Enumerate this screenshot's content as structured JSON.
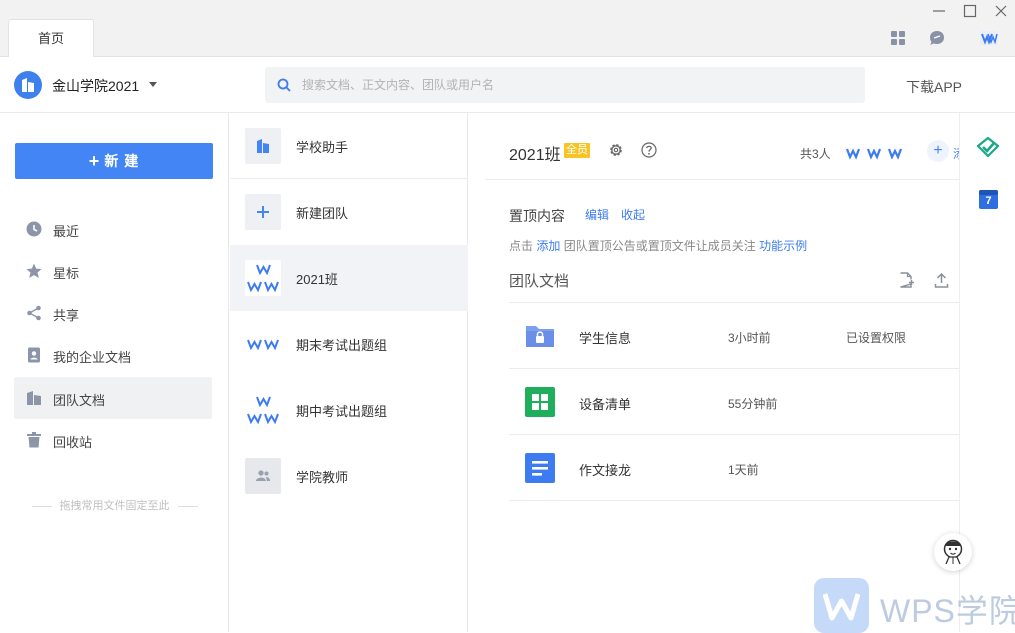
{
  "titlebar": {
    "tabs": [
      {
        "label": "首页",
        "active": true
      }
    ],
    "icons": [
      "apps-grid-icon",
      "chat-bubble-icon",
      "wps-logo-icon"
    ],
    "window_controls": [
      "minimize-icon",
      "maximize-icon",
      "close-icon"
    ]
  },
  "header": {
    "org_name": "金山学院2021",
    "search_placeholder": "搜索文档、正文内容、团队或用户名",
    "download_label": "下载APP"
  },
  "sidebar": {
    "new_button": "新 建",
    "items": [
      {
        "label": "最近",
        "icon": "clock-icon",
        "active": false
      },
      {
        "label": "星标",
        "icon": "star-icon",
        "active": false
      },
      {
        "label": "共享",
        "icon": "share-icon",
        "active": false
      },
      {
        "label": "我的企业文档",
        "icon": "person-doc-icon",
        "active": false
      },
      {
        "label": "团队文档",
        "icon": "team-doc-icon",
        "active": true
      },
      {
        "label": "回收站",
        "icon": "trash-icon",
        "active": false
      }
    ],
    "pin_hint": "拖拽常用文件固定至此"
  },
  "teams": [
    {
      "name": "学校助手",
      "avatar": "school-assistant-icon",
      "active": false
    },
    {
      "name": "新建团队",
      "avatar": "plus-icon",
      "active": false
    },
    {
      "name": "2021班",
      "avatar": "team-avatar-wps",
      "active": true
    },
    {
      "name": "期末考试出题组",
      "avatar": "team-avatar-wps",
      "active": false
    },
    {
      "name": "期中考试出题组",
      "avatar": "team-avatar-wps",
      "active": false
    },
    {
      "name": "学院教师",
      "avatar": "people-icon",
      "active": false
    }
  ],
  "main": {
    "team_title": "2021班",
    "member_badge": "全员",
    "member_count": "共3人",
    "add_member_label": "添",
    "pinned": {
      "title": "置顶内容",
      "edit": "编辑",
      "collapse": "收起",
      "hint_prefix": "点击",
      "hint_add": "添加",
      "hint_middle": "团队置顶公告或置顶文件让成员关注",
      "hint_example": "功能示例"
    },
    "docs_title": "团队文档",
    "docs": [
      {
        "name": "学生信息",
        "time": "3小时前",
        "permission": "已设置权限",
        "icon": "locked-folder-icon",
        "color": "#6b8fe8"
      },
      {
        "name": "设备清单",
        "time": "55分钟前",
        "permission": "",
        "icon": "spreadsheet-icon",
        "color": "#1fae5b"
      },
      {
        "name": "作文接龙",
        "time": "1天前",
        "permission": "",
        "icon": "document-icon",
        "color": "#3d7cf0"
      }
    ]
  },
  "rightrail": {
    "items": [
      "task-check-icon",
      "calendar-icon"
    ],
    "calendar_day": "7"
  },
  "watermark": {
    "text": "WPS学院"
  },
  "colors": {
    "accent": "#4485f5",
    "badge": "#f8c325",
    "sheet": "#1fae5b"
  }
}
